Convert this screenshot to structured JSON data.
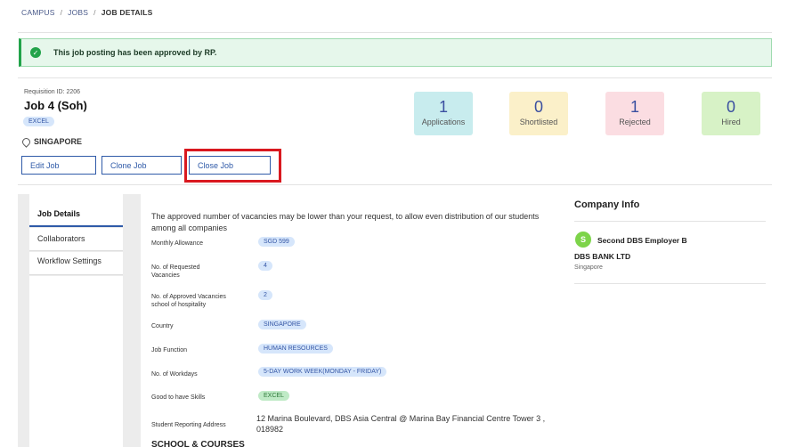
{
  "breadcrumb": {
    "campus": "CAMPUS",
    "jobs": "JOBS",
    "current": "JOB DETAILS",
    "separator": "/"
  },
  "alert": {
    "message": "This job posting has been approved by RP.",
    "icon": "check-circle-icon",
    "color": "#22a34a"
  },
  "job": {
    "requisition": "Requisition ID: 2206",
    "title": "Job 4 (Soh)",
    "tag": "EXCEL",
    "location": "SINGAPORE",
    "location_icon": "map-pin-icon"
  },
  "actions": {
    "edit": "Edit Job",
    "clone": "Clone Job",
    "close": "Close Job"
  },
  "stats": [
    {
      "count": "1",
      "label": "Applications",
      "color": "#c8ecee"
    },
    {
      "count": "0",
      "label": "Shortlisted",
      "color": "#fbf0c9"
    },
    {
      "count": "1",
      "label": "Rejected",
      "color": "#fbdde2"
    },
    {
      "count": "0",
      "label": "Hired",
      "color": "#d7f2c6"
    }
  ],
  "sidebar": {
    "items": [
      "Job Details",
      "Collaborators",
      "Workflow Settings"
    ]
  },
  "details": {
    "intro": "The approved number of vacancies may be lower than your request, to allow even distribution of our students among all companies",
    "rows": [
      {
        "label": "Monthly Allowance",
        "value": "SGD 599"
      },
      {
        "label": "No. of Requested Vacancies",
        "value": "4"
      },
      {
        "label": "No. of Approved Vacancies school of hospitality",
        "value": "2"
      },
      {
        "label": "Country",
        "value": "SINGAPORE"
      },
      {
        "label": "Job Function",
        "value": "HUMAN RESOURCES"
      },
      {
        "label": "No. of Workdays",
        "value": "5-DAY WORK WEEK(MONDAY - FRIDAY)"
      },
      {
        "label": "Good to have Skills",
        "value": "EXCEL"
      },
      {
        "label": "Student Reporting Address",
        "value": "12 Marina Boulevard, DBS Asia Central @ Marina Bay Financial Centre Tower 3 , 018982"
      }
    ],
    "next_section": "SCHOOL & COURSES"
  },
  "company": {
    "heading": "Company Info",
    "avatar_letter": "S",
    "employer": "Second DBS Employer B",
    "name": "DBS BANK LTD",
    "location": "Singapore"
  }
}
